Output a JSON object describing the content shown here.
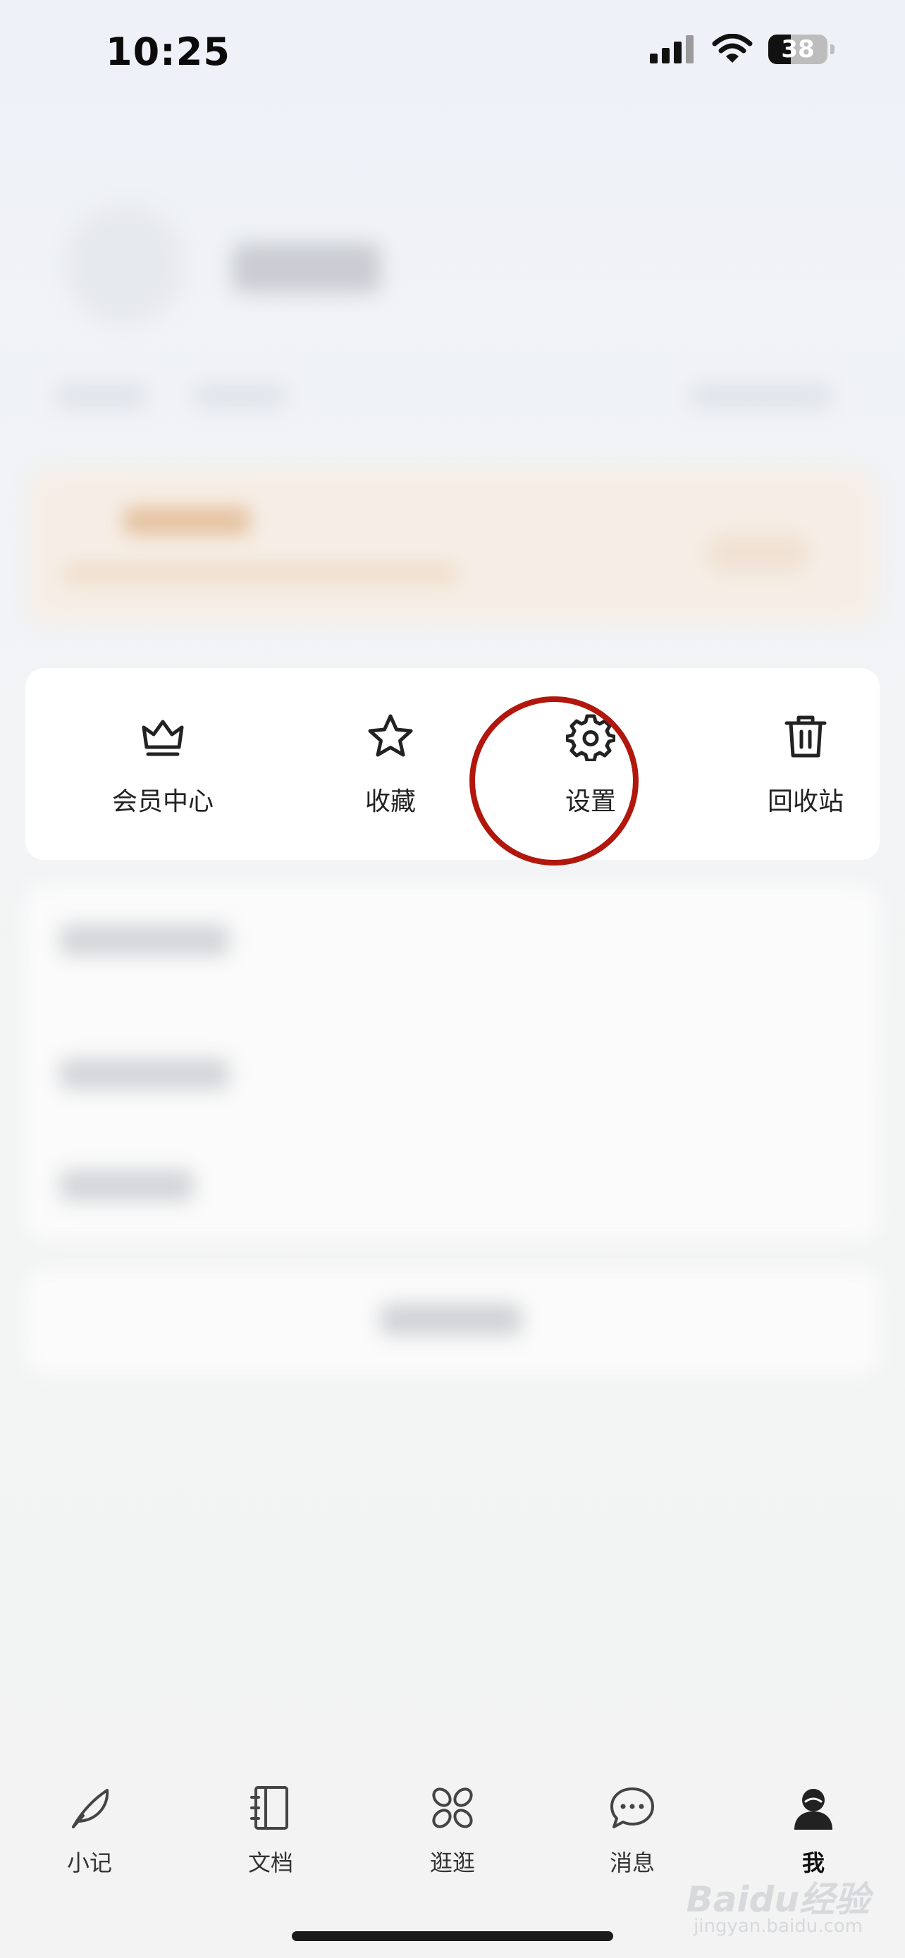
{
  "status_bar": {
    "time": "10:25",
    "battery": "38",
    "battery_level": 0.38
  },
  "quick_actions": [
    {
      "label": "会员中心",
      "icon": "crown-icon"
    },
    {
      "label": "收藏",
      "icon": "star-icon"
    },
    {
      "label": "设置",
      "icon": "gear-icon"
    },
    {
      "label": "回收站",
      "icon": "trash-icon"
    }
  ],
  "tab_bar": [
    {
      "label": "小记",
      "icon": "feather-icon",
      "active": false
    },
    {
      "label": "文档",
      "icon": "notebook-icon",
      "active": false
    },
    {
      "label": "逛逛",
      "icon": "grid-petals-icon",
      "active": false
    },
    {
      "label": "消息",
      "icon": "chat-bubble-icon",
      "active": false
    },
    {
      "label": "我",
      "icon": "user-icon",
      "active": true
    }
  ],
  "watermark": {
    "brand": "Baidu经验",
    "url": "jingyan.baidu.com"
  },
  "colors": {
    "highlight": "#b1170d",
    "card": "#ffffff",
    "vip_accent": "#e4bf9c"
  }
}
